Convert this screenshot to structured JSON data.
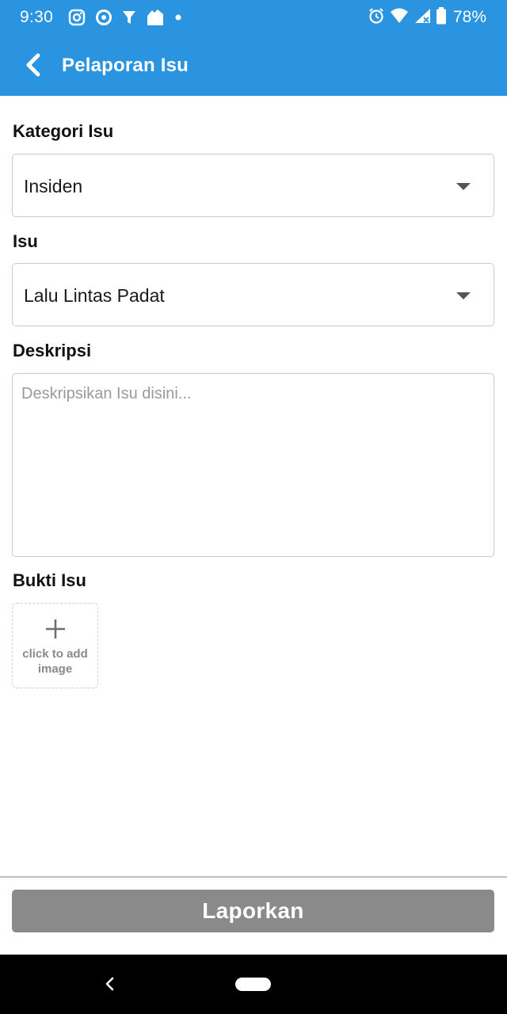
{
  "status_bar": {
    "time": "9:30",
    "battery_percent": "78%",
    "left_icons": [
      "instagram-icon",
      "location-target-icon",
      "filter-funnel-icon",
      "app-shop-icon",
      "dot-icon"
    ],
    "right_icons": [
      "alarm-icon",
      "wifi-icon",
      "cell-signal-icon",
      "battery-icon"
    ]
  },
  "app_bar": {
    "title": "Pelaporan Isu",
    "back_icon": "chevron-left-icon",
    "color": "#2b94e0"
  },
  "form": {
    "category": {
      "label": "Kategori Isu",
      "selected": "Insiden"
    },
    "issue": {
      "label": "Isu",
      "selected": "Lalu Lintas Padat"
    },
    "description": {
      "label": "Deskripsi",
      "value": "",
      "placeholder": "Deskripsikan Isu disini..."
    },
    "evidence": {
      "label": "Bukti Isu",
      "add_image_text": "click to add image"
    }
  },
  "submit": {
    "label": "Laporkan",
    "color": "#8a8a8a"
  }
}
